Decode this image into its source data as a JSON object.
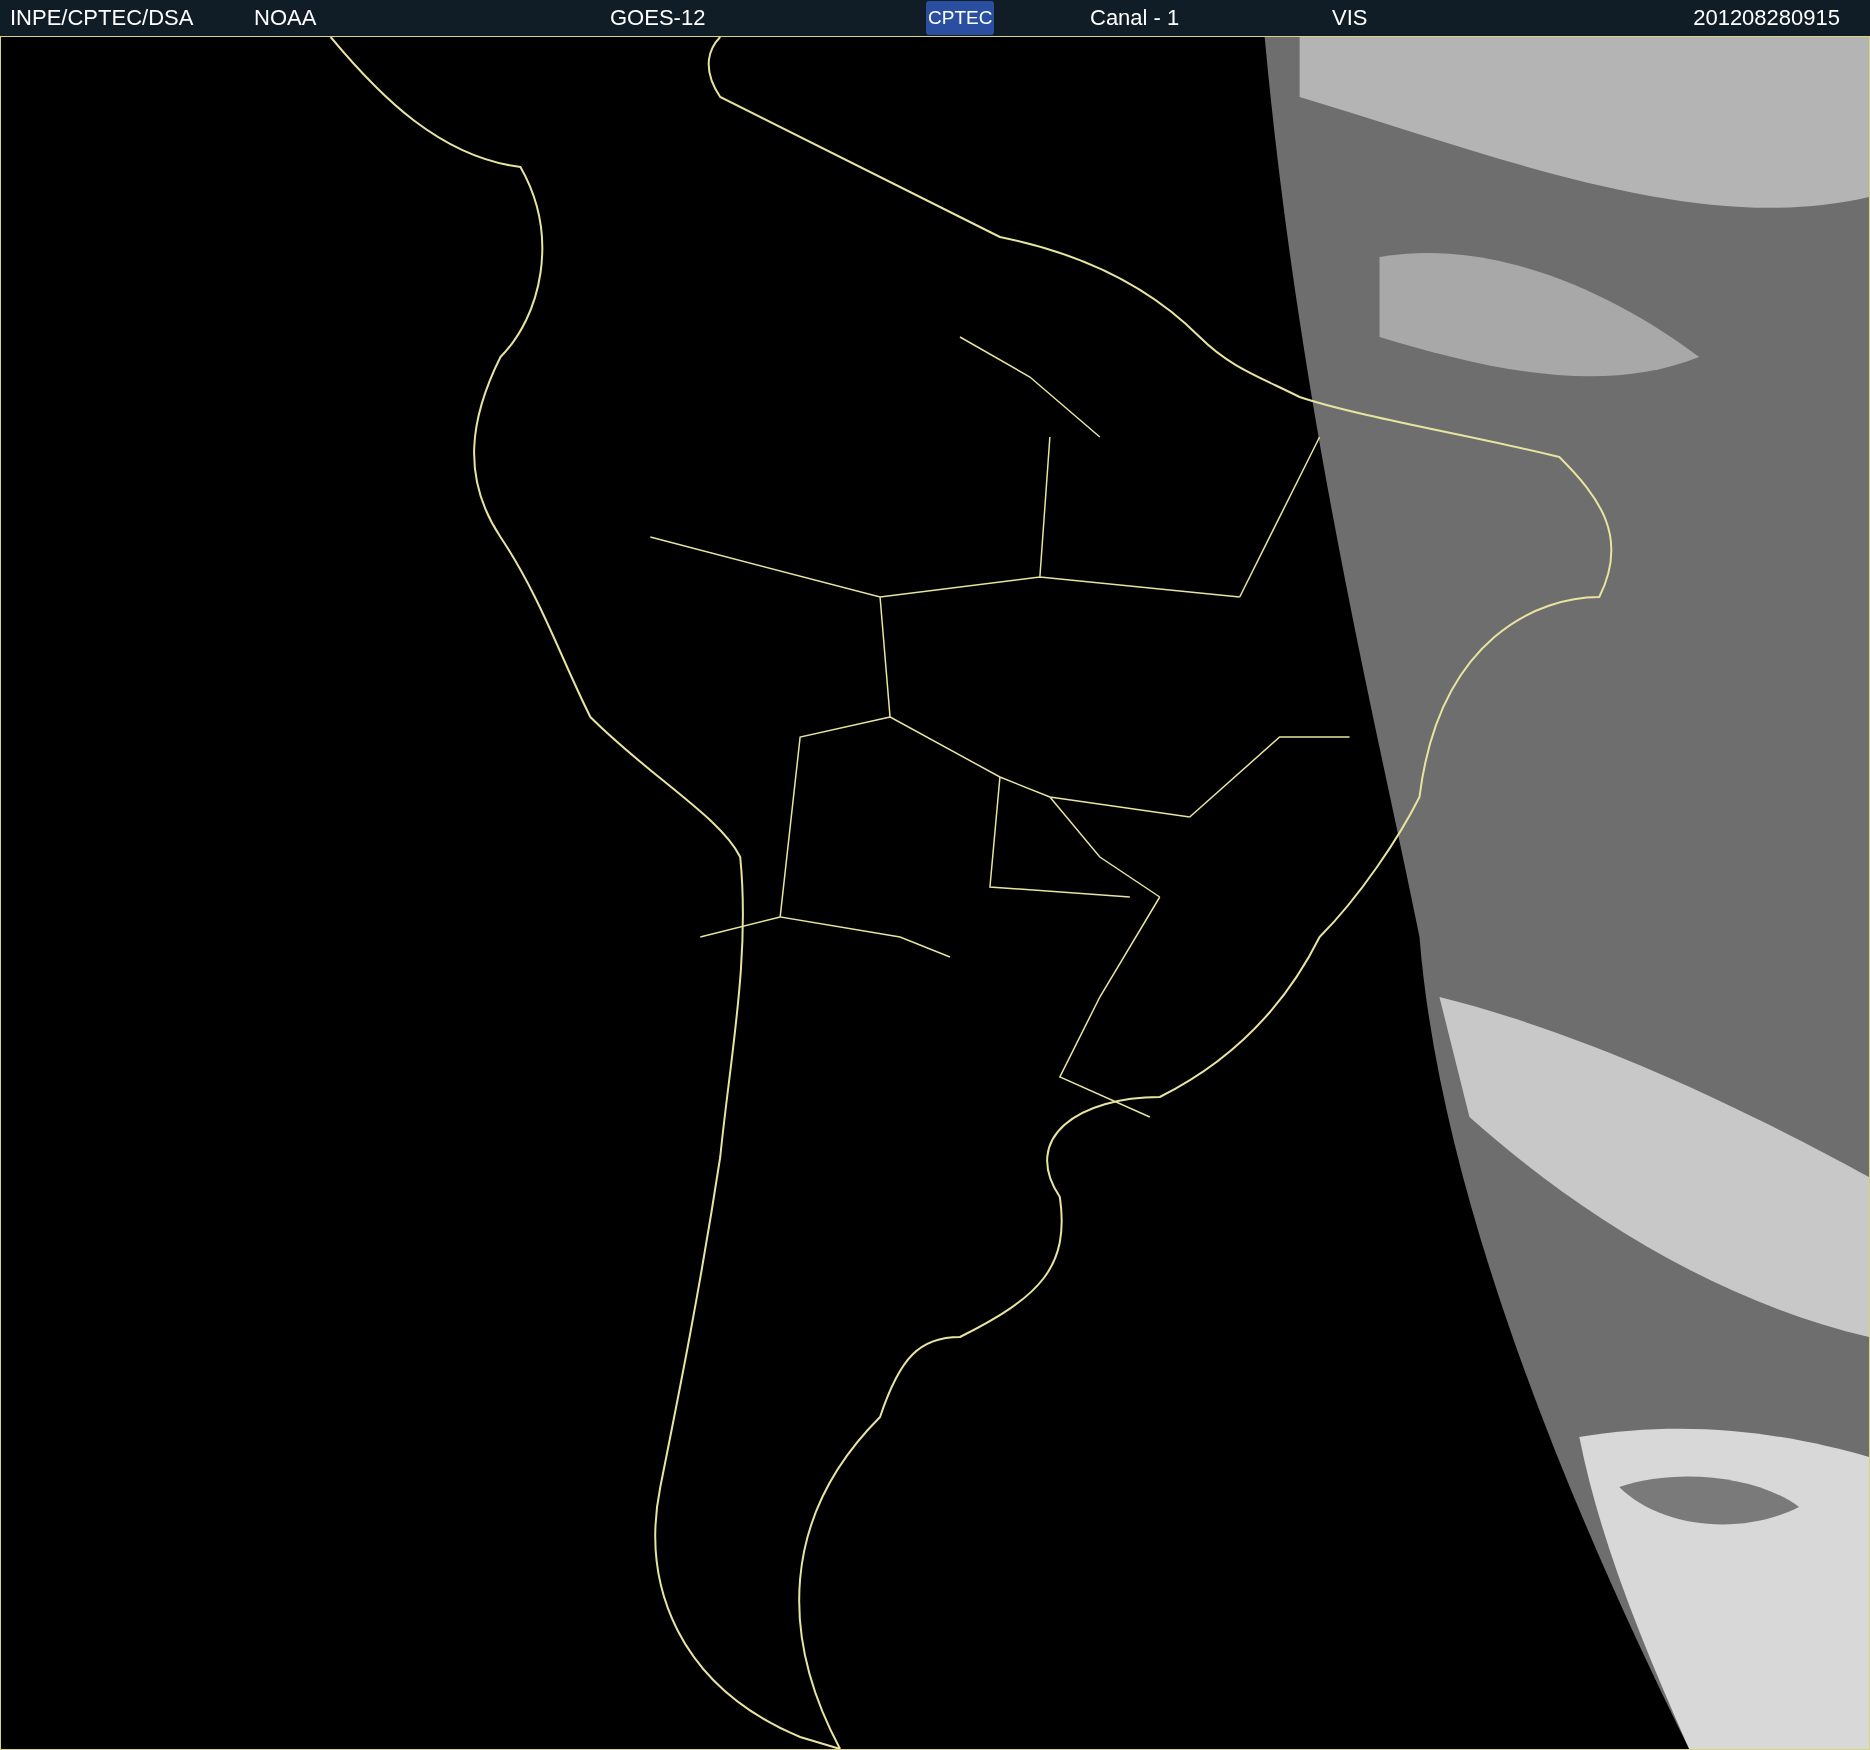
{
  "header": {
    "items": [
      {
        "kind": "text",
        "text": "INPE/CPTEC/DSA"
      },
      {
        "kind": "text",
        "text": "NOAA"
      },
      {
        "kind": "text",
        "text": "GOES-12"
      },
      {
        "kind": "logo",
        "text": "CPTEC"
      },
      {
        "kind": "text",
        "text": "Canal - 1"
      },
      {
        "kind": "text",
        "text": "VIS"
      },
      {
        "kind": "text",
        "text": "201208280915"
      }
    ]
  }
}
